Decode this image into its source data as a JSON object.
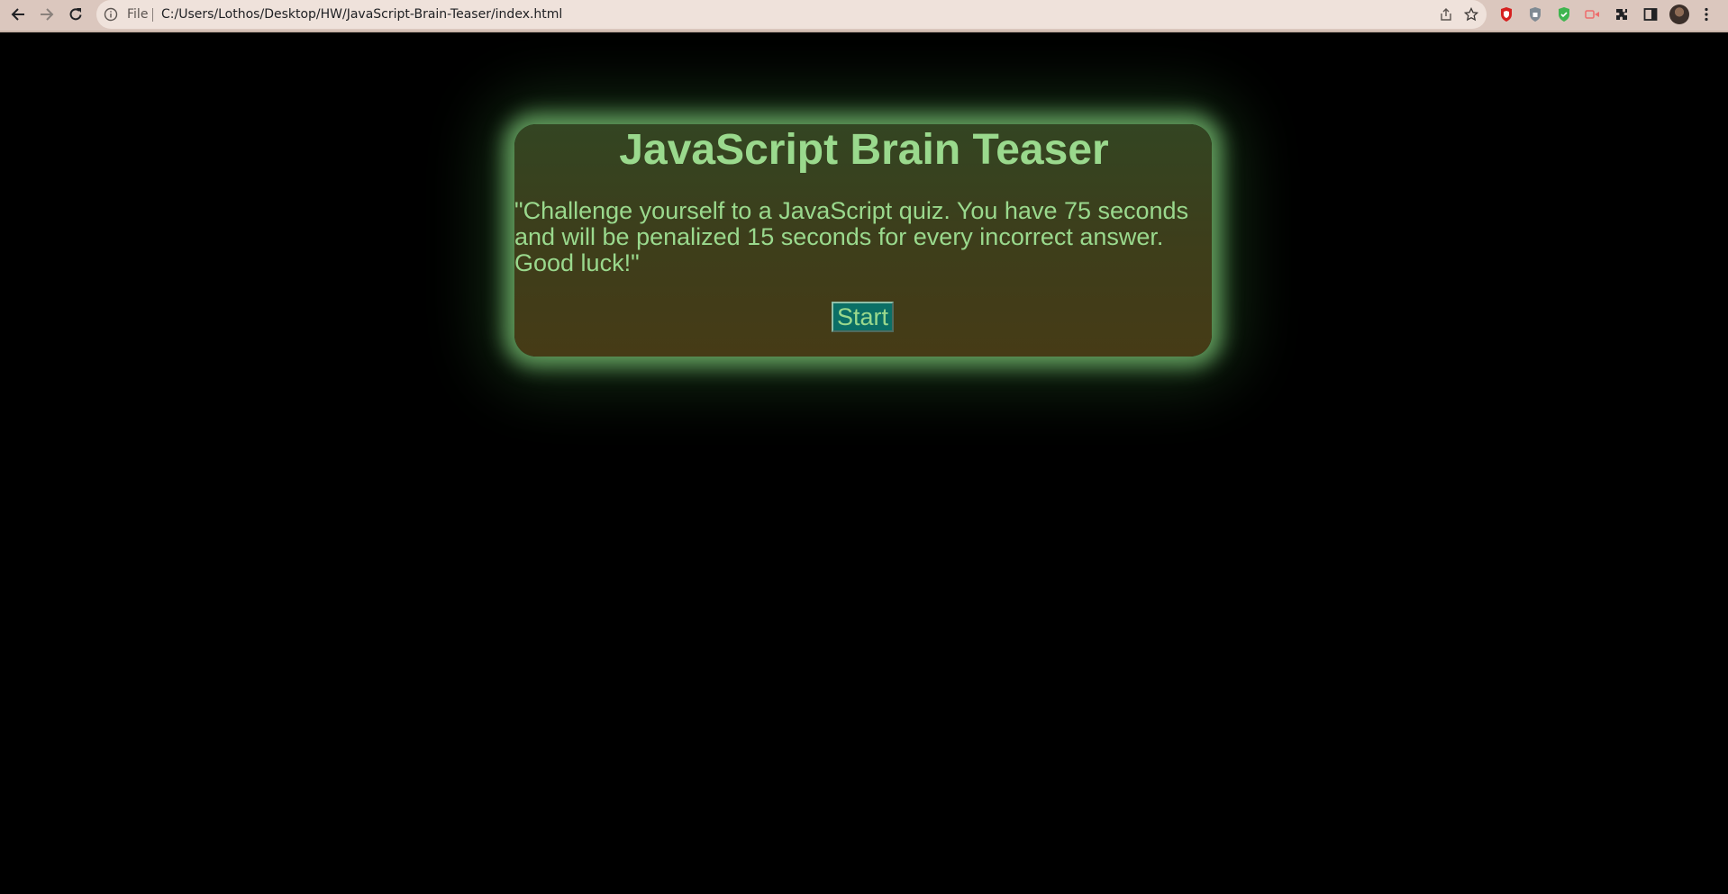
{
  "browser": {
    "scheme_label": "File",
    "url": "C:/Users/Lothos/Desktop/HW/JavaScript-Brain-Teaser/index.html",
    "toolbar_color": "#dbc7be"
  },
  "page": {
    "title": "JavaScript Brain Teaser",
    "intro": "\"Challenge yourself to a JavaScript quiz. You have 75 seconds and will be penalized 15 seconds for every incorrect answer. Good luck!\"",
    "start_label": "Start",
    "text_color": "#9ad98d",
    "button_color": "#0b6f66"
  },
  "icons": [
    "back-icon",
    "forward-icon",
    "reload-icon",
    "info-icon",
    "share-icon",
    "bookmark-star-icon",
    "brave-shield-icon",
    "privacy-shield-icon",
    "green-shield-icon",
    "screen-share-icon",
    "extensions-icon",
    "side-panel-icon",
    "profile-avatar",
    "menu-icon"
  ]
}
